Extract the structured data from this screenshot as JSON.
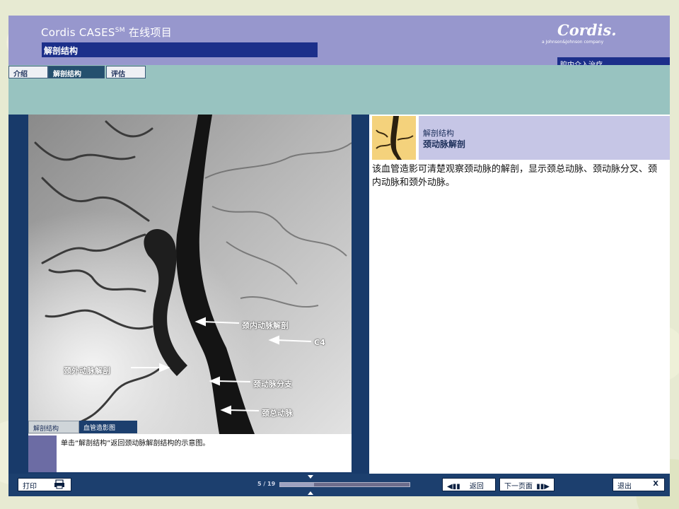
{
  "header": {
    "app_title": "Cordis CASES",
    "app_title_sup": "SM",
    "app_title_suffix": " 在线项目",
    "section": "解剖结构",
    "brand": "Cordis.",
    "brand_sub": "a Johnson&Johnson company",
    "specialty": "腔内介入治疗"
  },
  "nav": {
    "tabs": [
      {
        "label": "介绍",
        "active": false
      },
      {
        "label": "解剖结构",
        "active": true
      },
      {
        "label": "评估",
        "active": false
      }
    ]
  },
  "image_panel": {
    "annotations": [
      "颈内动脉解剖",
      "C4",
      "颈外动脉解剖",
      "颈动脉分支",
      "颈总动脉"
    ],
    "sub_tabs": [
      {
        "label": "解剖结构",
        "active": false
      },
      {
        "label": "血管造影图",
        "active": true
      }
    ],
    "caption": "单击“解剖结构”返回颈动脉解剖结构的示意图。"
  },
  "info_panel": {
    "category": "解剖结构",
    "title": "颈动脉解剖",
    "body": "该血管造影可清楚观察颈动脉的解剖，显示颈总动脉、颈动脉分叉、颈内动脉和颈外动脉。"
  },
  "footer": {
    "print_label": "打印",
    "back_label": "返回",
    "next_label": "下一页面",
    "exit_label": "退出",
    "exit_icon": "X",
    "page_indicator": "5 / 19",
    "progress": 0.26
  },
  "colors": {
    "header_bg": "#9797cd",
    "navy": "#1c2f8a",
    "teal": "#98c3c0",
    "footer_bg": "#1c3f6e"
  }
}
